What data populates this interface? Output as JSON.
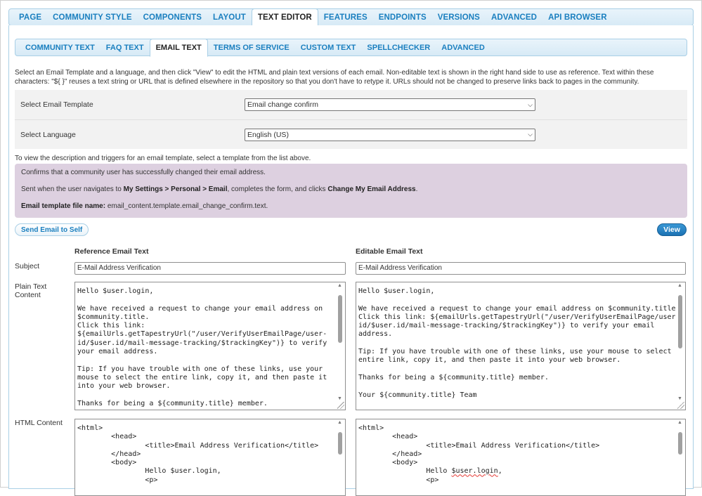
{
  "main_tabs": [
    {
      "label": "PAGE"
    },
    {
      "label": "COMMUNITY STYLE"
    },
    {
      "label": "COMPONENTS"
    },
    {
      "label": "LAYOUT"
    },
    {
      "label": "TEXT EDITOR"
    },
    {
      "label": "FEATURES"
    },
    {
      "label": "ENDPOINTS"
    },
    {
      "label": "VERSIONS"
    },
    {
      "label": "ADVANCED"
    },
    {
      "label": "API BROWSER"
    }
  ],
  "active_main_tab": "TEXT EDITOR",
  "sub_tabs": [
    {
      "label": "COMMUNITY TEXT"
    },
    {
      "label": "FAQ TEXT"
    },
    {
      "label": "EMAIL TEXT"
    },
    {
      "label": "TERMS OF SERVICE"
    },
    {
      "label": "CUSTOM TEXT"
    },
    {
      "label": "SPELLCHECKER"
    },
    {
      "label": "ADVANCED"
    }
  ],
  "active_sub_tab": "EMAIL TEXT",
  "intro_text": "Select an Email Template and a language, and then click \"View\" to edit the HTML and plain text versions of each email. Non-editable text is shown in the right hand side to use as reference. Text within these characters: \"${ }\" reuses a text string or URL that is defined elsewhere in the repository so that you don't have to retype it. URLs should not be changed to preserve links back to pages in the community.",
  "template_select": {
    "label": "Select Email Template",
    "value": "Email change confirm"
  },
  "language_select": {
    "label": "Select Language",
    "value": "English (US)"
  },
  "hint_text": "To view the description and triggers for an email template, select a template from the list above.",
  "info": {
    "description": "Confirms that a community user has successfully changed their email address.",
    "sent_prefix": "Sent when the user navigates to ",
    "sent_path": "My Settings > Personal > Email",
    "sent_middle": ", completes the form, and clicks ",
    "sent_button": "Change My Email Address",
    "sent_suffix": ".",
    "file_label": "Email template file name:",
    "file_name": " email_content.template.email_change_confirm.text."
  },
  "send_button": "Send Email to Self",
  "view_button": "View",
  "reference_heading": "Reference Email Text",
  "editable_heading": "Editable Email Text",
  "labels": {
    "subject": "Subject",
    "plain_text_1": "Plain Text",
    "plain_text_2": "Content",
    "html_content": "HTML Content"
  },
  "reference": {
    "subject": "E-Mail Address Verification",
    "plain": "Hello $user.login,\n\nWe have received a request to change your email address on\n$community.title.\nClick this link:\n${emailUrls.getTapestryUrl(\"/user/VerifyUserEmailPage/user-\nid/$user.id/mail-message-tracking/$trackingKey\")} to verify\nyour email address.\n\nTip: If you have trouble with one of these links, use your\nmouse to select the entire link, copy it, and then paste it\ninto your web browser.\n\nThanks for being a ${community.title} member.",
    "html": "<html>\n        <head>\n                <title>Email Address Verification</title>\n        </head>\n        <body>\n                Hello $user.login,\n                <p>"
  },
  "editable": {
    "subject": "E-Mail Address Verification",
    "plain": "Hello $user.login,\n\nWe have received a request to change your email address on $community.title.\nClick this link: ${emailUrls.getTapestryUrl(\"/user/VerifyUserEmailPage/user-\nid/$user.id/mail-message-tracking/$trackingKey\")} to verify your email\naddress.\n\nTip: If you have trouble with one of these links, use your mouse to select the\nentire link, copy it, and then paste it into your web browser.\n\nThanks for being a ${community.title} member.\n\nYour ${community.title} Team",
    "html_pre": "<html>\n        <head>\n                <title>Email Address Verification</title>\n        </head>\n        <body>\n                Hello ",
    "html_squiggle": "$user.login",
    "html_post": ",\n                <p>"
  }
}
